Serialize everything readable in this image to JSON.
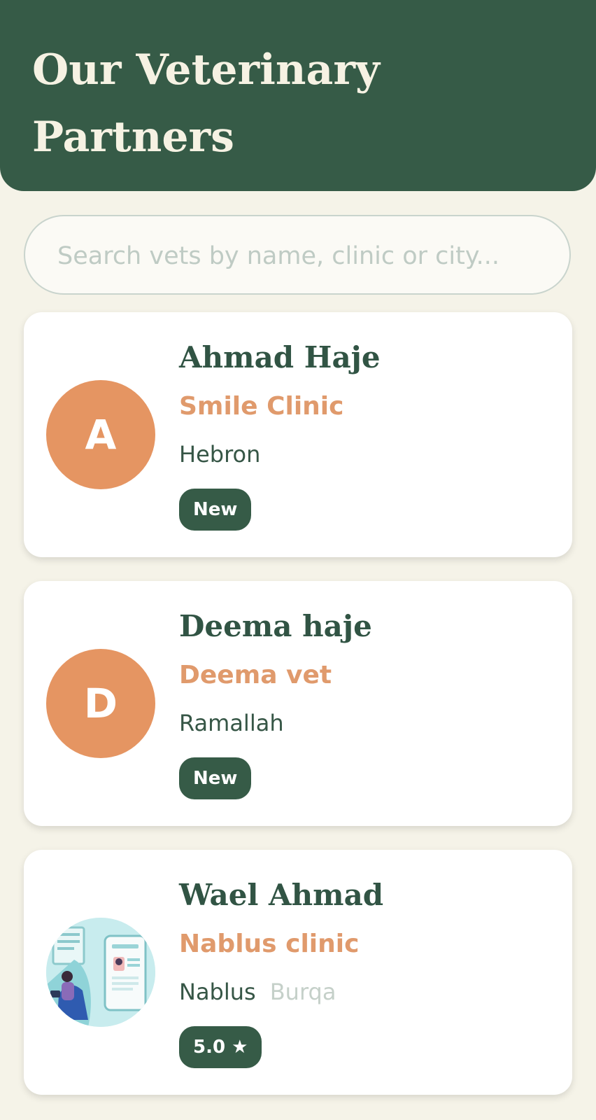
{
  "header": {
    "title": "Our Veterinary Partners"
  },
  "search": {
    "placeholder": "Search vets by name, clinic or city..."
  },
  "vets": [
    {
      "initial": "A",
      "name": "Ahmad Haje",
      "clinic": "Smile Clinic",
      "city": "Hebron",
      "area": "",
      "badge": "New"
    },
    {
      "initial": "D",
      "name": "Deema haje",
      "clinic": "Deema vet",
      "city": "Ramallah",
      "area": "",
      "badge": "New"
    },
    {
      "initial": "",
      "name": "Wael Ahmad",
      "clinic": "Nablus clinic",
      "city": "Nablus",
      "area": "Burqa",
      "badge": "5.0 ★"
    }
  ],
  "colors": {
    "brand": "#365b47",
    "accent": "#e59562",
    "background": "#f5f3e8"
  }
}
